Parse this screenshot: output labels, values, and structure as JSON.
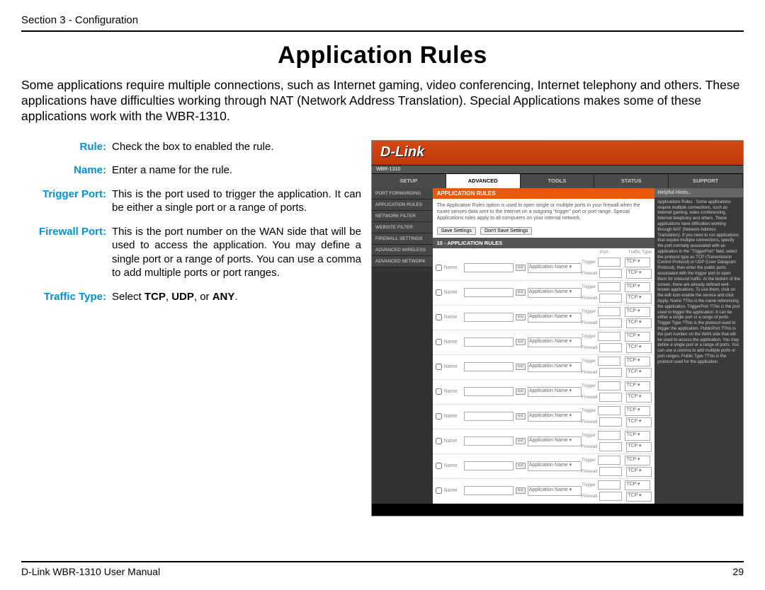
{
  "header": {
    "section": "Section 3 - Configuration"
  },
  "title": "Application Rules",
  "intro": "Some applications require multiple connections, such as Internet gaming, video conferencing, Internet telephony and others. These applications have difficulties working through NAT (Network Address Translation). Special Applications makes some of these applications work with the WBR-1310.",
  "definitions": [
    {
      "term": "Rule:",
      "desc": "Check the box to enabled the rule."
    },
    {
      "term": "Name:",
      "desc": "Enter a name for the rule."
    },
    {
      "term": "Trigger Port:",
      "desc": "This is the port used to trigger the application. It can be either a single port or a range of ports."
    },
    {
      "term": "Firewall Port:",
      "desc": "This is the port number on the WAN side that will be used to access the application. You may define a single port or a range of ports. You can use a comma to add multiple ports or port ranges."
    },
    {
      "term": "Traffic Type:",
      "desc_html": "Select <b>TCP</b>, <b>UDP</b>, or <b>ANY</b>."
    }
  ],
  "screenshot": {
    "logo": "D-Link",
    "model": "WBR-1310",
    "tabs": [
      "SETUP",
      "ADVANCED",
      "TOOLS",
      "STATUS",
      "SUPPORT"
    ],
    "active_tab": 1,
    "side_nav": [
      "PORT FORWARDING",
      "APPLICATION RULES",
      "NETWORK FILTER",
      "WEBSITE FILTER",
      "FIREWALL SETTINGS",
      "ADVANCED WIRELESS",
      "ADVANCED NETWORK"
    ],
    "panel_title": "APPLICATION RULES",
    "panel_desc": "The Application Rules option is used to open single or multiple ports in your firewall when the router senses data sent to the Internet on a outgoing \"trigger\" port or port range. Special Applications rules apply to all computers on your internal network.",
    "buttons": {
      "save": "Save Settings",
      "dont": "Don't Save Settings"
    },
    "rules_header": "10 - APPLICATION RULES",
    "col_port": "Port",
    "col_traffic": "Traffic Type",
    "row_labels": {
      "name": "Name",
      "arrow": "<<",
      "app": "Application Name",
      "trigger": "Trigger",
      "firewall": "Firewall",
      "tcp": "TCP"
    },
    "rule_count": 10,
    "help_title": "Helpful Hints..",
    "help_body": "Applications Rules : Some applications require multiple connections, such as Internet gaming, video conferencing, Internet telephony and others. These applications have difficulties working through NAT (Network Address Translation). If you need to run applications that require multiple connections, specify the port normally associated with an application in the \"TriggerPort\" field, select the protocol type as TCP (Transmission Control Protocol) or UDP (User Datagram Protocol), then enter the public ports associated with the trigger port to open them for inbound traffic. At the bottom of the screen, there are already defined well-known applications. To use them, click on the edit icon enable the service and click Apply. Name ?This is the name referencing the application. TriggerPort ?This is the port used to trigger the application. It can be either a single port or a range of ports. Trigger Type ?This is the protocol used to trigger the application. PublicPort ?This is the port number on the WAN side that will be used to access the application. You may define a single port or a range of ports. You can use a comma to add multiple ports or port ranges. Public Type ?This is the protocol used for the application."
  },
  "footer": {
    "manual": "D-Link WBR-1310 User Manual",
    "page": "29"
  }
}
